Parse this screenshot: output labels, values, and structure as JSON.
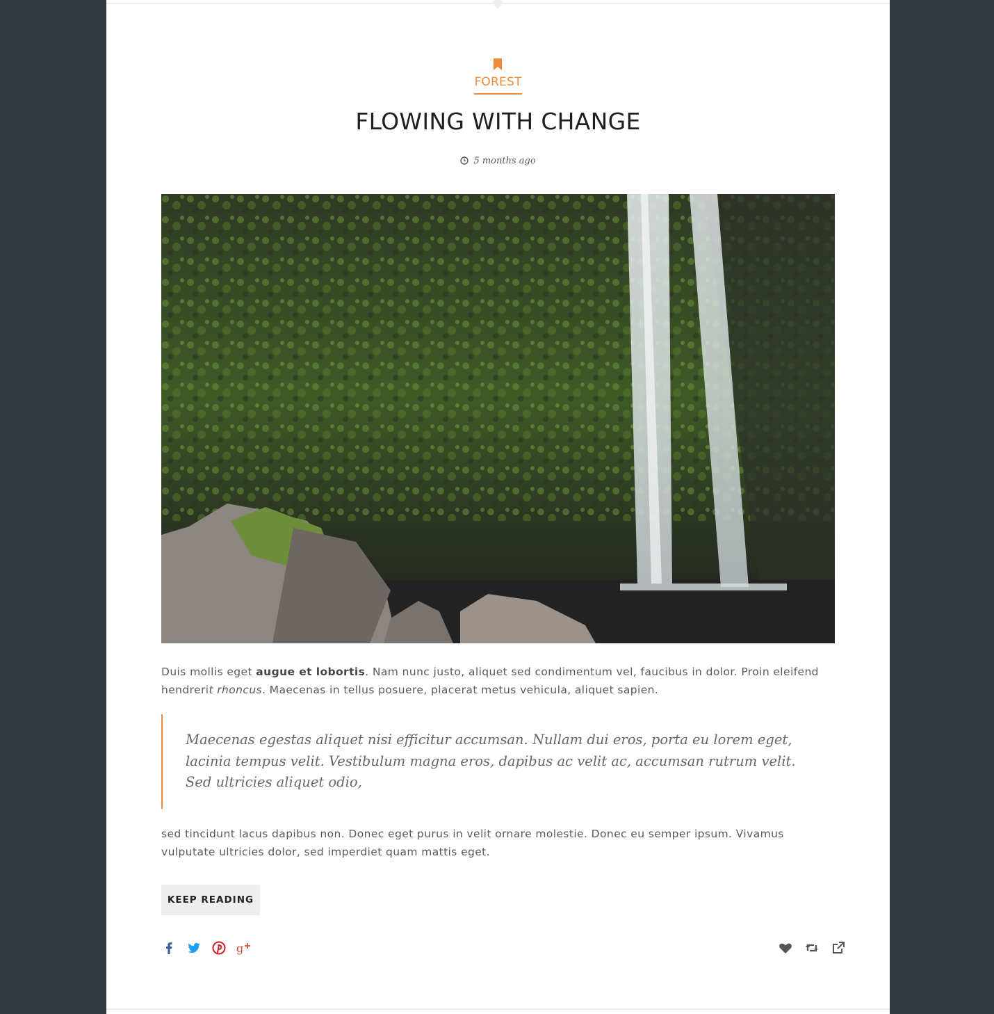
{
  "post": {
    "category": "FOREST",
    "title": "FLOWING WITH CHANGE",
    "time_ago": "5 months ago",
    "image_alt": "Waterfall over a moss-covered rock face with boulders in the foreground",
    "intro": {
      "part1": "Duis mollis eget ",
      "bold": "augue et lobortis",
      "part2": ". Nam nunc justo, aliquet sed condimentum vel, faucibus in dolor. Proin eleifend hendreri",
      "italic": "t rhoncus",
      "part3": ". Maecenas in tellus posuere, placerat metus vehicula, aliquet sapien."
    },
    "quote": "Maecenas egestas aliquet nisi efficitur accumsan. Nullam dui eros, porta eu lorem eget, lacinia tempus velit. Vestibulum magna eros, dapibus ac velit ac, accumsan rutrum velit. Sed ultricies aliquet odio,",
    "outro": "sed tincidunt lacus dapibus non. Donec eget purus in velit ornare molestie. Donec eu semper ipsum. Vivamus vulputate ultricies dolor, sed imperdiet quam mattis eget.",
    "keep_reading": "KEEP READING"
  },
  "share_icons": [
    {
      "name": "facebook-icon",
      "color": "#3b5998"
    },
    {
      "name": "twitter-icon",
      "color": "#1da1f2"
    },
    {
      "name": "pinterest-icon",
      "color": "#cb2027"
    },
    {
      "name": "google-plus-icon",
      "color": "#dd4b39"
    }
  ],
  "action_icons": [
    {
      "name": "heart-icon",
      "color": "#555555"
    },
    {
      "name": "retweet-icon",
      "color": "#555555"
    },
    {
      "name": "external-link-icon",
      "color": "#555555"
    }
  ],
  "colors": {
    "accent": "#ef8b3b",
    "page_background": "#333a3e",
    "card_background": "#ffffff"
  }
}
